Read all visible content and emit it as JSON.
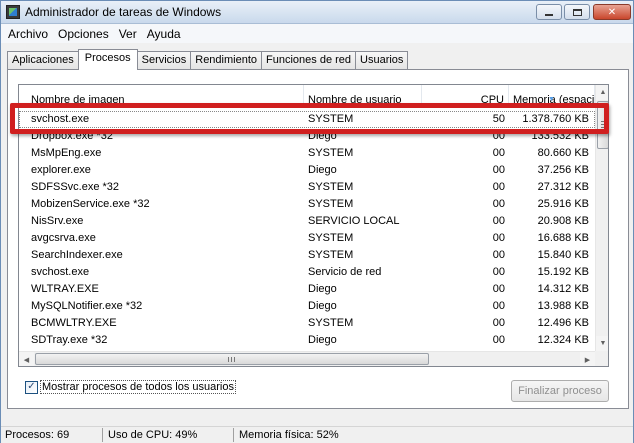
{
  "window": {
    "title": "Administrador de tareas de Windows",
    "close_glyph": "✕"
  },
  "menu": [
    "Archivo",
    "Opciones",
    "Ver",
    "Ayuda"
  ],
  "tabs": [
    {
      "label": "Aplicaciones",
      "active": false
    },
    {
      "label": "Procesos",
      "active": true
    },
    {
      "label": "Servicios",
      "active": false
    },
    {
      "label": "Rendimiento",
      "active": false
    },
    {
      "label": "Funciones de red",
      "active": false
    },
    {
      "label": "Usuarios",
      "active": false
    }
  ],
  "table": {
    "columns": {
      "name": "Nombre de imagen",
      "user": "Nombre de usuario",
      "cpu": "CPU",
      "memory": "Memoria (espaci..."
    },
    "rows": [
      {
        "name": "svchost.exe",
        "user": "SYSTEM",
        "cpu": "50",
        "memory": "1.378.760 KB"
      },
      {
        "name": "Dropbox.exe *32",
        "user": "Diego",
        "cpu": "00",
        "memory": "133.532 KB"
      },
      {
        "name": "MsMpEng.exe",
        "user": "SYSTEM",
        "cpu": "00",
        "memory": "80.660 KB"
      },
      {
        "name": "explorer.exe",
        "user": "Diego",
        "cpu": "00",
        "memory": "37.256 KB"
      },
      {
        "name": "SDFSSvc.exe *32",
        "user": "SYSTEM",
        "cpu": "00",
        "memory": "27.312 KB"
      },
      {
        "name": "MobizenService.exe *32",
        "user": "SYSTEM",
        "cpu": "00",
        "memory": "25.916 KB"
      },
      {
        "name": "NisSrv.exe",
        "user": "SERVICIO LOCAL",
        "cpu": "00",
        "memory": "20.908 KB"
      },
      {
        "name": "avgcsrva.exe",
        "user": "SYSTEM",
        "cpu": "00",
        "memory": "16.688 KB"
      },
      {
        "name": "SearchIndexer.exe",
        "user": "SYSTEM",
        "cpu": "00",
        "memory": "15.840 KB"
      },
      {
        "name": "svchost.exe",
        "user": "Servicio de red",
        "cpu": "00",
        "memory": "15.192 KB"
      },
      {
        "name": "WLTRAY.EXE",
        "user": "Diego",
        "cpu": "00",
        "memory": "14.312 KB"
      },
      {
        "name": "MySQLNotifier.exe *32",
        "user": "Diego",
        "cpu": "00",
        "memory": "13.988 KB"
      },
      {
        "name": "BCMWLTRY.EXE",
        "user": "SYSTEM",
        "cpu": "00",
        "memory": "12.496 KB"
      },
      {
        "name": "SDTray.exe *32",
        "user": "Diego",
        "cpu": "00",
        "memory": "12.324 KB"
      }
    ],
    "selected_row": 0,
    "sort_column": "memory",
    "sort_direction": "descending"
  },
  "show_all_users": {
    "label": "Mostrar procesos de todos los usuarios",
    "checked": true
  },
  "end_process_button": {
    "label": "Finalizar proceso",
    "enabled": false
  },
  "status": {
    "processes": "Procesos: 69",
    "cpu": "Uso de CPU: 49%",
    "memory": "Memoria física: 52%"
  },
  "colors": {
    "highlight_border": "#d01f1f",
    "sort_arrow": "#569de5",
    "disabled_text": "#8f8f8f"
  },
  "icons": {
    "app": "task-manager-icon",
    "checkbox": "checkmark-icon",
    "scroll_up": "▲",
    "scroll_down": "▼",
    "scroll_left": "◀",
    "scroll_right": "▶",
    "sort": "▼"
  }
}
